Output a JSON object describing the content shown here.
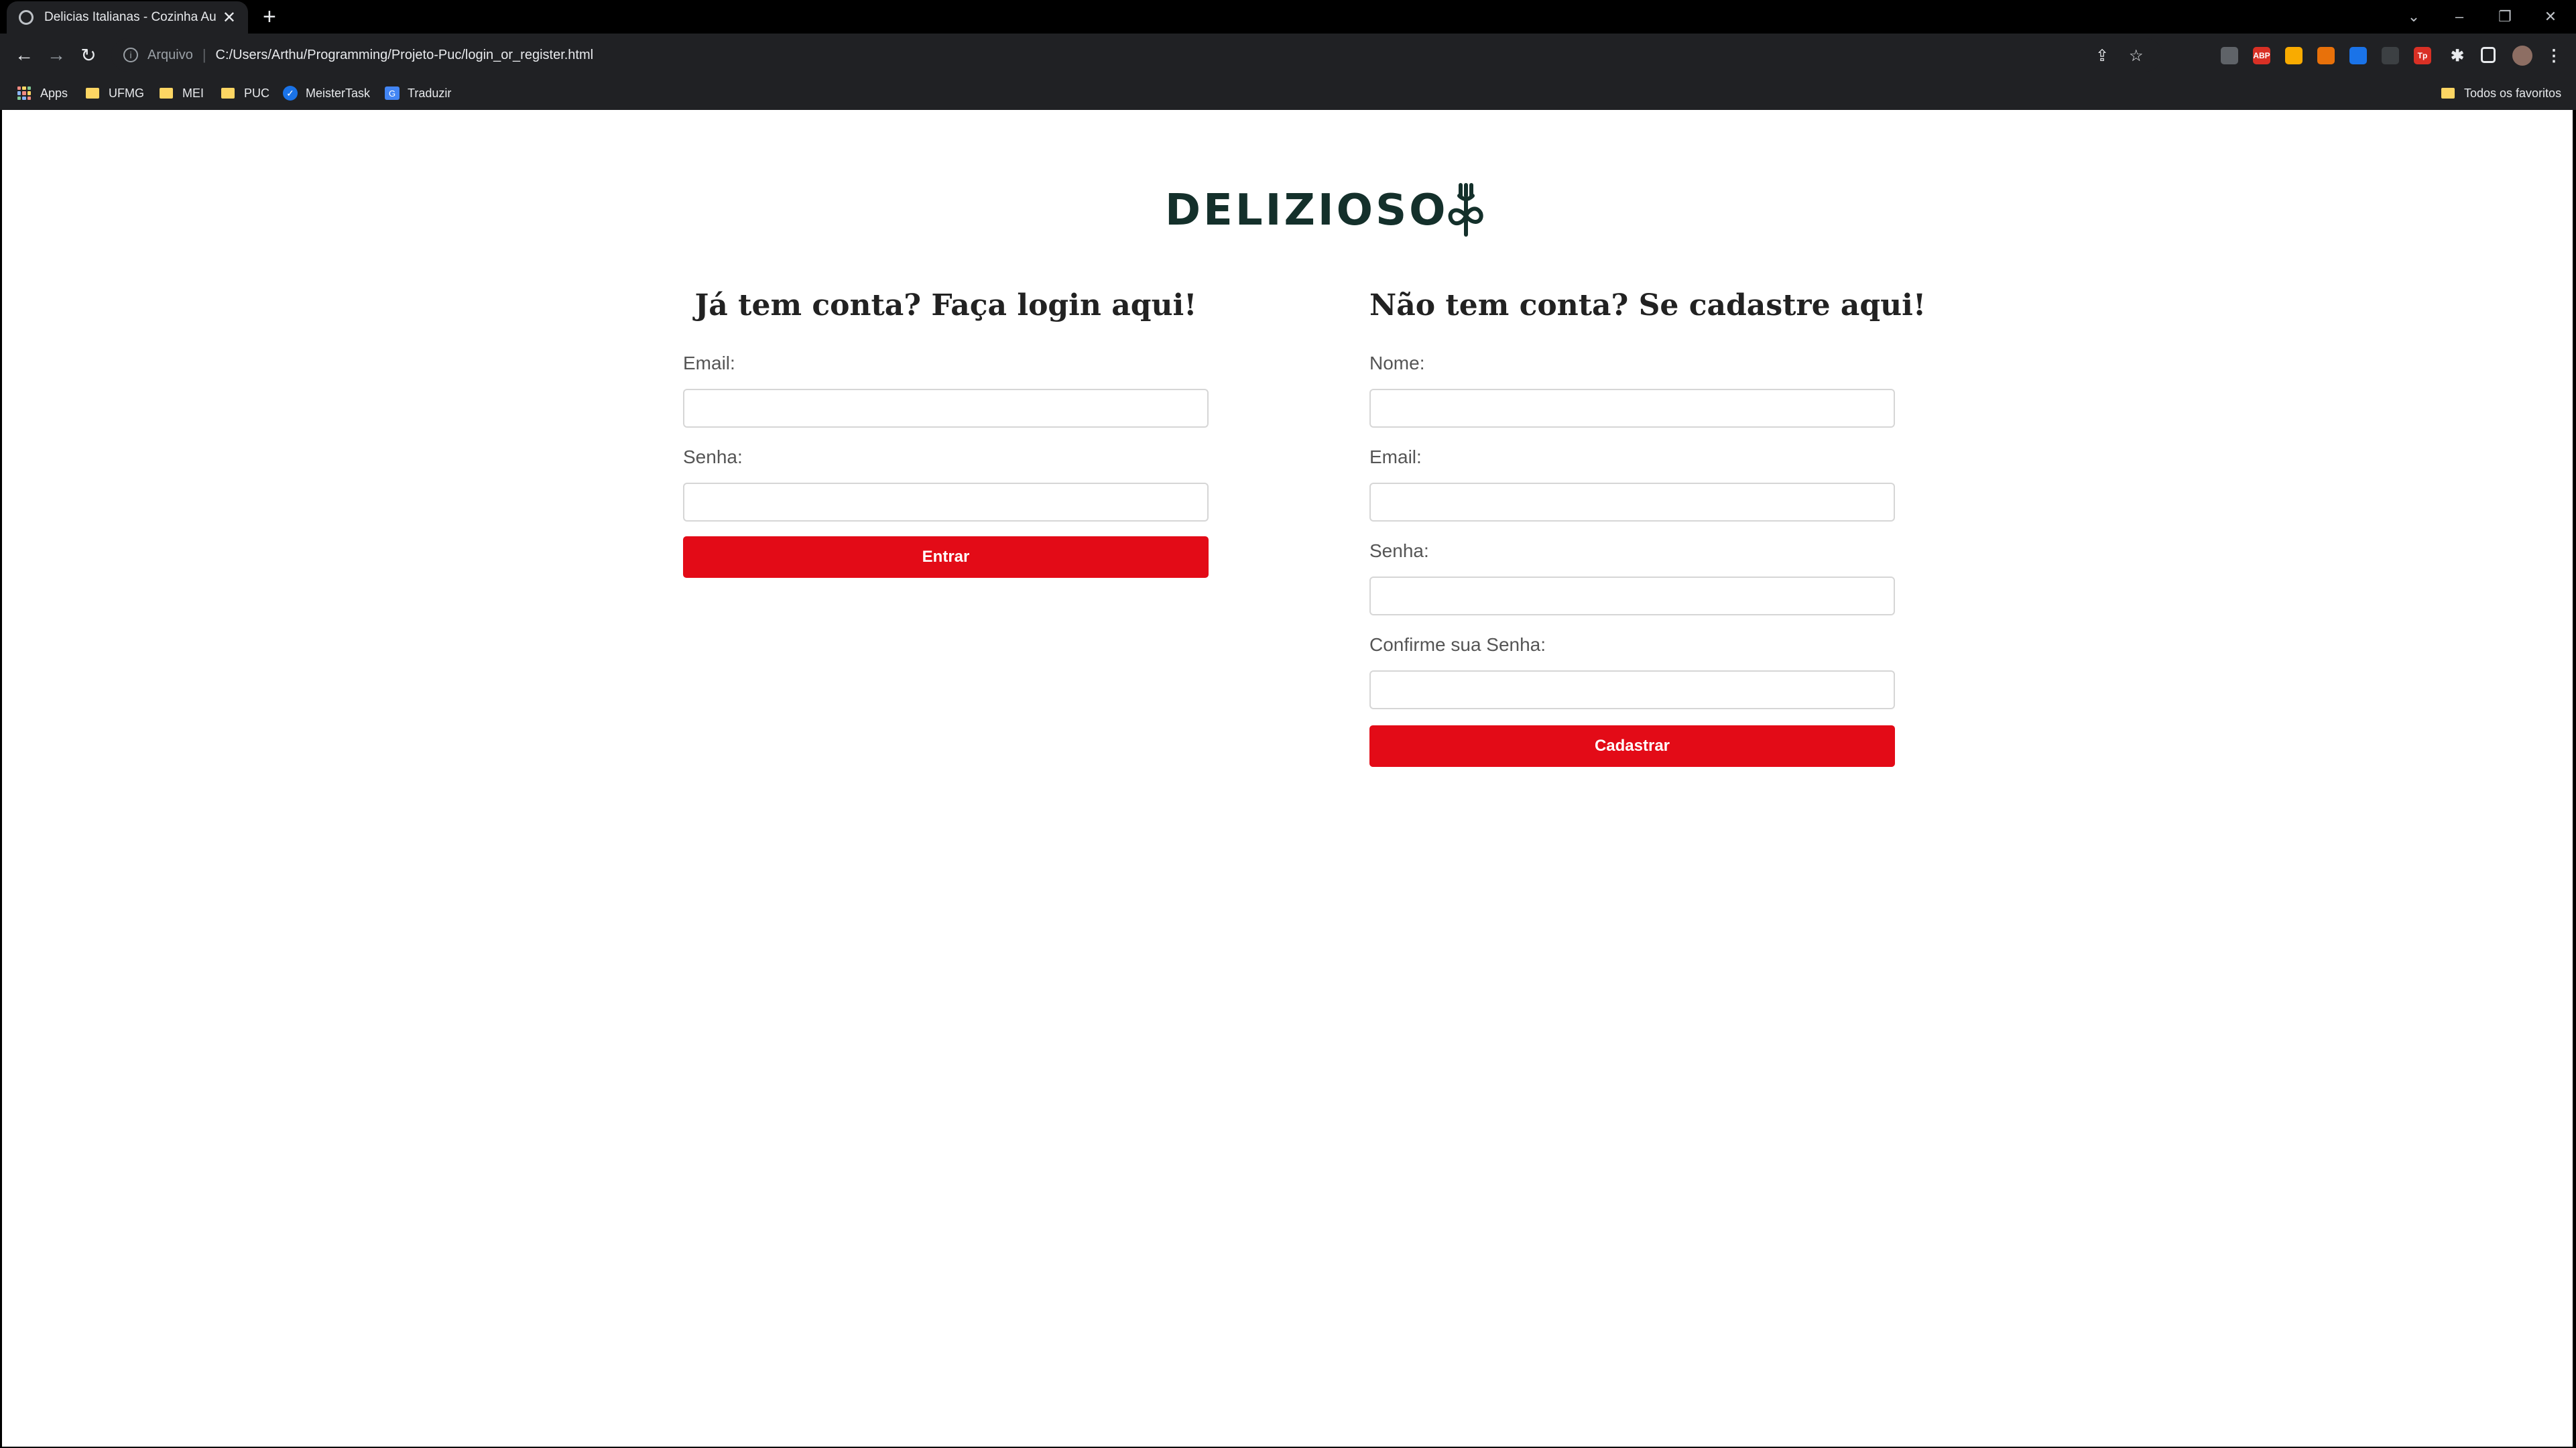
{
  "browser": {
    "tab_title": "Delicias Italianas - Cozinha Autê",
    "address_scheme": "Arquivo",
    "address_url": "C:/Users/Arthu/Programming/Projeto-Puc/login_or_register.html",
    "extensions": [
      {
        "icon": "extension-icon-1",
        "label": "",
        "color": "#5f6368"
      },
      {
        "icon": "adblock-icon",
        "label": "ABP",
        "color": "#d93025"
      },
      {
        "icon": "extension-icon-3",
        "label": "",
        "color": "#f9ab00"
      },
      {
        "icon": "extension-icon-4",
        "label": "",
        "color": "#e8710a"
      },
      {
        "icon": "extension-icon-5",
        "label": "",
        "color": "#1a73e8"
      },
      {
        "icon": "extension-icon-6",
        "label": "",
        "color": "#3c4043"
      },
      {
        "icon": "extension-icon-7",
        "label": "Tp",
        "color": "#d93025"
      }
    ]
  },
  "bookmarks": [
    {
      "label": "Apps",
      "icon": "apps-grid-icon"
    },
    {
      "label": "UFMG",
      "icon": "folder-icon"
    },
    {
      "label": "MEI",
      "icon": "folder-icon"
    },
    {
      "label": "PUC",
      "icon": "folder-icon"
    },
    {
      "label": "MeisterTask",
      "icon": "meistertask-icon"
    },
    {
      "label": "Traduzir",
      "icon": "translate-icon"
    }
  ],
  "all_bookmarks_label": "Todos os favoritos",
  "logo": {
    "text": "DELIZIOSO"
  },
  "login": {
    "title": "Já tem conta? Faça login aqui!",
    "email_label": "Email:",
    "password_label": "Senha:",
    "submit_label": "Entrar"
  },
  "register": {
    "title": "Não tem conta? Se cadastre aqui!",
    "name_label": "Nome:",
    "email_label": "Email:",
    "password_label": "Senha:",
    "confirm_label": "Confirme sua Senha:",
    "submit_label": "Cadastrar"
  },
  "colors": {
    "accent": "#e30b17",
    "logo": "#14302b"
  }
}
